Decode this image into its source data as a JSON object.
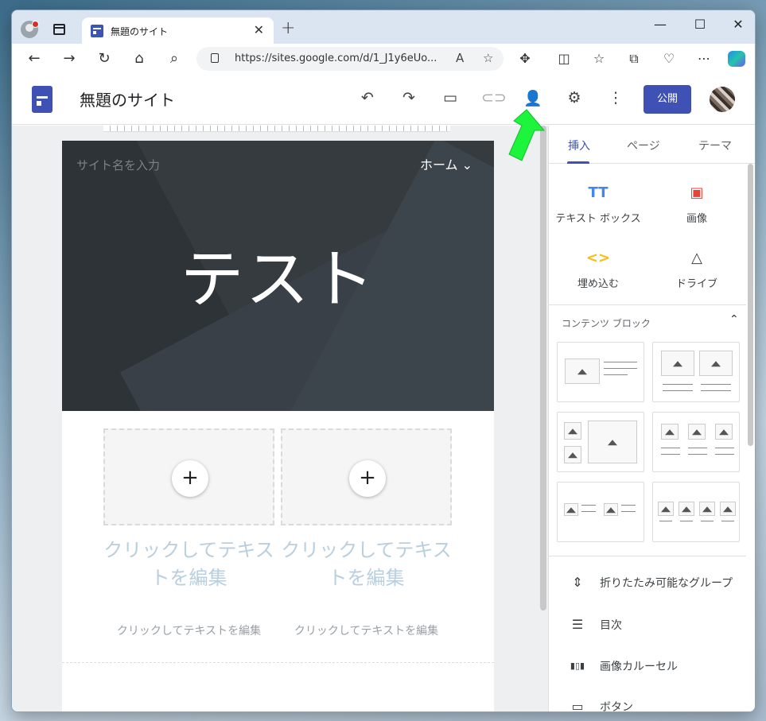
{
  "browser": {
    "tab_title": "無題のサイト",
    "tab_close": "✕",
    "new_tab": "+",
    "url": "https://sites.google.com/d/1_J1y6eUo...",
    "window_controls": [
      "—",
      "☐",
      "✕"
    ]
  },
  "app": {
    "site_title": "無題のサイト",
    "publish_label": "公開"
  },
  "page": {
    "site_name_placeholder": "サイト名を入力",
    "nav_home": "ホーム ⌄",
    "hero_title": "テスト",
    "columns": [
      {
        "heading": "クリックしてテキストを編集",
        "body": "クリックしてテキストを編集",
        "plus": "+"
      },
      {
        "heading": "クリックしてテキストを編集",
        "body": "クリックしてテキストを編集",
        "plus": "+"
      }
    ]
  },
  "panel": {
    "tabs": [
      "挿入",
      "ページ",
      "テーマ"
    ],
    "quick_items": [
      {
        "label": "テキスト ボックス",
        "icon": "TT",
        "color": "#4285f4"
      },
      {
        "label": "画像",
        "icon": "▣",
        "color": "#ea4335"
      },
      {
        "label": "埋め込む",
        "icon": "<>",
        "color": "#fbbc04"
      },
      {
        "label": "ドライブ",
        "icon": "△",
        "color": "#3c4043"
      }
    ],
    "content_blocks_title": "コンテンツ ブロック",
    "list_items": [
      {
        "label": "折りたたみ可能なグループ",
        "icon": "⇕"
      },
      {
        "label": "目次",
        "icon": "☰"
      },
      {
        "label": "画像カルーセル",
        "icon": "▮▯▮"
      },
      {
        "label": "ボタン",
        "icon": "▭"
      }
    ]
  },
  "colors": {
    "brand": "#3f51b5",
    "annotation_arrow": "#1cf53c"
  }
}
